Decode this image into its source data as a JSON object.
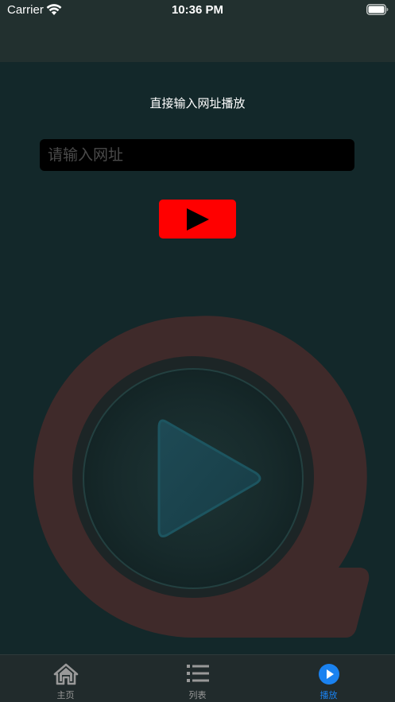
{
  "status_bar": {
    "carrier": "Carrier",
    "time": "10:36 PM"
  },
  "main": {
    "heading": "直接输入网址播放",
    "url_input": {
      "value": "",
      "placeholder": "请输入网址"
    },
    "play_button_icon": "play-icon"
  },
  "tabbar": {
    "tabs": [
      {
        "label": "主页",
        "icon": "home-icon",
        "active": false
      },
      {
        "label": "列表",
        "icon": "list-icon",
        "active": false
      },
      {
        "label": "播放",
        "icon": "play-circle-icon",
        "active": true
      }
    ]
  },
  "colors": {
    "background": "#13282a",
    "play_button": "#ff0000",
    "active_tab": "#1a82f0",
    "inactive_tab": "#999999"
  }
}
